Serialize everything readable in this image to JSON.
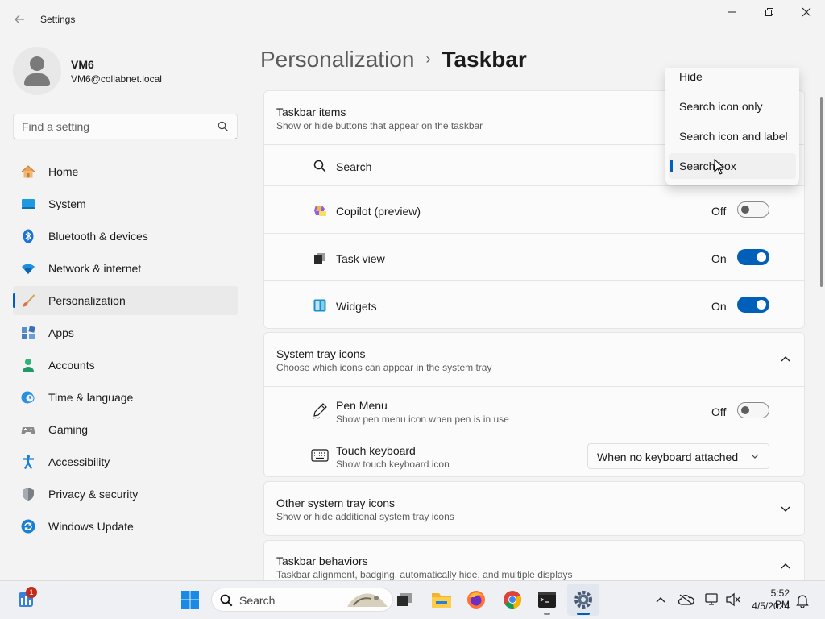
{
  "window": {
    "title": "Settings",
    "back_icon": "back-arrow-icon",
    "controls": [
      "minimize",
      "maximize",
      "close"
    ]
  },
  "user": {
    "name": "VM6",
    "email": "VM6@collabnet.local"
  },
  "search": {
    "placeholder": "Find a setting",
    "icon": "search-icon"
  },
  "nav": {
    "items": [
      {
        "label": "Home",
        "icon": "home-icon"
      },
      {
        "label": "System",
        "icon": "system-icon"
      },
      {
        "label": "Bluetooth & devices",
        "icon": "bluetooth-icon"
      },
      {
        "label": "Network & internet",
        "icon": "wifi-icon"
      },
      {
        "label": "Personalization",
        "icon": "brush-icon",
        "selected": true
      },
      {
        "label": "Apps",
        "icon": "apps-icon"
      },
      {
        "label": "Accounts",
        "icon": "accounts-icon"
      },
      {
        "label": "Time & language",
        "icon": "clock-globe-icon"
      },
      {
        "label": "Gaming",
        "icon": "gamepad-icon"
      },
      {
        "label": "Accessibility",
        "icon": "accessibility-icon"
      },
      {
        "label": "Privacy & security",
        "icon": "shield-icon"
      },
      {
        "label": "Windows Update",
        "icon": "update-icon"
      }
    ]
  },
  "breadcrumb": {
    "parent": "Personalization",
    "separator": "›",
    "current": "Taskbar"
  },
  "taskbar_items": {
    "title": "Taskbar items",
    "subtitle": "Show or hide buttons that appear on the taskbar",
    "rows": [
      {
        "label": "Search",
        "icon": "search-icon"
      },
      {
        "label": "Copilot (preview)",
        "icon": "copilot-icon",
        "state": "Off"
      },
      {
        "label": "Task view",
        "icon": "task-view-icon",
        "state": "On"
      },
      {
        "label": "Widgets",
        "icon": "widgets-icon",
        "state": "On"
      }
    ]
  },
  "search_flyout": {
    "options": [
      "Hide",
      "Search icon only",
      "Search icon and label",
      "Search box"
    ],
    "selected": "Search box"
  },
  "system_tray": {
    "title": "System tray icons",
    "subtitle": "Choose which icons can appear in the system tray",
    "expanded": true,
    "rows": [
      {
        "label": "Pen Menu",
        "sub": "Show pen menu icon when pen is in use",
        "icon": "pen-icon",
        "state": "Off"
      },
      {
        "label": "Touch keyboard",
        "sub": "Show touch keyboard icon",
        "icon": "keyboard-icon",
        "value": "When no keyboard attached"
      }
    ]
  },
  "other_tray": {
    "title": "Other system tray icons",
    "subtitle": "Show or hide additional system tray icons",
    "expanded": false
  },
  "behaviors": {
    "title": "Taskbar behaviors",
    "subtitle": "Taskbar alignment, badging, automatically hide, and multiple displays",
    "expanded": true
  },
  "os_taskbar": {
    "widgets_badge": "1",
    "search_label": "Search",
    "apps": [
      "start-icon",
      "task-view-icon",
      "file-explorer-icon",
      "firefox-icon",
      "chrome-icon",
      "terminal-icon",
      "settings-icon"
    ],
    "tray": [
      "chevron-up-icon",
      "onedrive-icon",
      "network-icon",
      "volume-icon",
      "notification-bell-icon"
    ],
    "time": "5:52 PM",
    "date": "4/5/2024"
  },
  "colors": {
    "accent": "#005fb8",
    "background": "#f3f3f3",
    "card": "#fbfbfb"
  }
}
